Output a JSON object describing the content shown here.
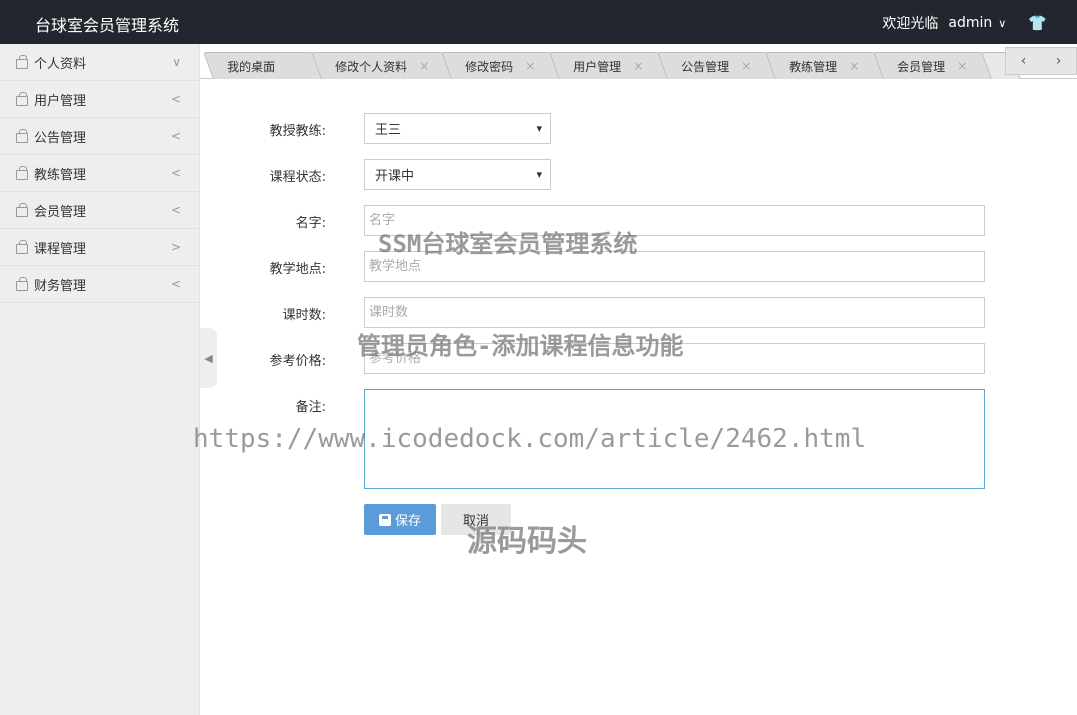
{
  "header": {
    "title": "台球室会员管理系统",
    "welcome": "欢迎光临",
    "username": "admin"
  },
  "sidebar": {
    "items": [
      {
        "label": "个人资料",
        "arrow": "∨"
      },
      {
        "label": "用户管理",
        "arrow": "<"
      },
      {
        "label": "公告管理",
        "arrow": "<"
      },
      {
        "label": "教练管理",
        "arrow": "<"
      },
      {
        "label": "会员管理",
        "arrow": "<"
      },
      {
        "label": "课程管理",
        "arrow": ">"
      },
      {
        "label": "财务管理",
        "arrow": "<"
      }
    ]
  },
  "tabs": [
    {
      "label": "我的桌面"
    },
    {
      "label": "修改个人资料"
    },
    {
      "label": "修改密码"
    },
    {
      "label": "用户管理"
    },
    {
      "label": "公告管理"
    },
    {
      "label": "教练管理"
    },
    {
      "label": "会员管理"
    }
  ],
  "form": {
    "coach_label": "教授教练:",
    "coach_value": "王三",
    "status_label": "课程状态:",
    "status_value": "开课中",
    "name_label": "名字:",
    "name_placeholder": "名字",
    "location_label": "教学地点:",
    "location_placeholder": "教学地点",
    "hours_label": "课时数:",
    "hours_placeholder": "课时数",
    "price_label": "参考价格:",
    "price_placeholder": "参考价格",
    "remark_label": "备注:",
    "save_label": "保存",
    "cancel_label": "取消"
  },
  "watermarks": {
    "line1": "SSM台球室会员管理系统",
    "line2": "管理员角色-添加课程信息功能",
    "line3": "https://www.icodedock.com/article/2462.html",
    "line4": "源码码头"
  }
}
